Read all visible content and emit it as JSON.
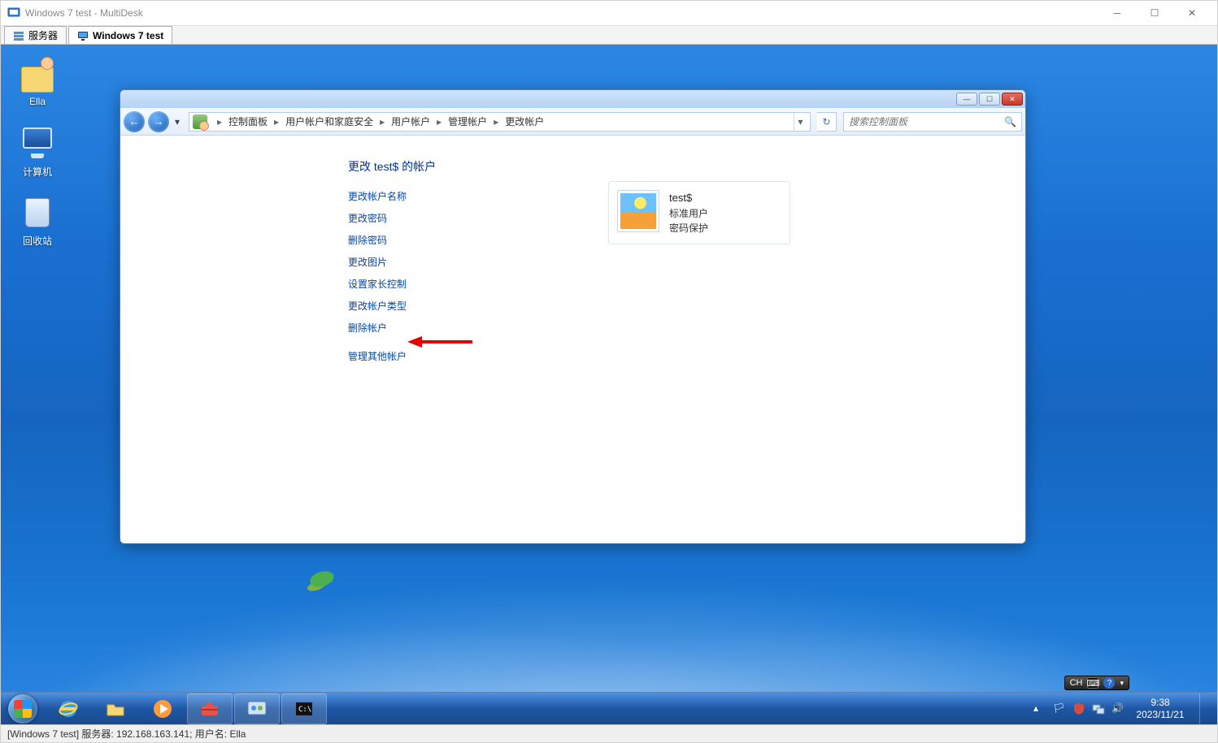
{
  "multidesk": {
    "title": "Windows 7 test - MultiDesk",
    "tabs": {
      "servers": "服务器",
      "session": "Windows 7 test"
    },
    "status": "[Windows 7 test] 服务器: 192.168.163.141; 用户名: Ella"
  },
  "desktop": {
    "icons": {
      "user_folder": "Ella",
      "computer": "计算机",
      "recycle_bin": "回收站"
    }
  },
  "control_panel": {
    "breadcrumb": [
      "控制面板",
      "用户帐户和家庭安全",
      "用户帐户",
      "管理帐户",
      "更改帐户"
    ],
    "search_placeholder": "搜索控制面板",
    "heading": "更改 test$ 的帐户",
    "links": {
      "change_name": "更改帐户名称",
      "change_password": "更改密码",
      "delete_password": "删除密码",
      "change_picture": "更改图片",
      "parental": "设置家长控制",
      "change_type": "更改帐户类型",
      "delete_account": "删除帐户",
      "manage_other": "管理其他帐户"
    },
    "account": {
      "name": "test$",
      "type": "标准用户",
      "pw": "密码保护"
    }
  },
  "taskbar": {
    "tray": {
      "lang": "CH",
      "time": "9:38",
      "date": "2023/11/21"
    }
  }
}
